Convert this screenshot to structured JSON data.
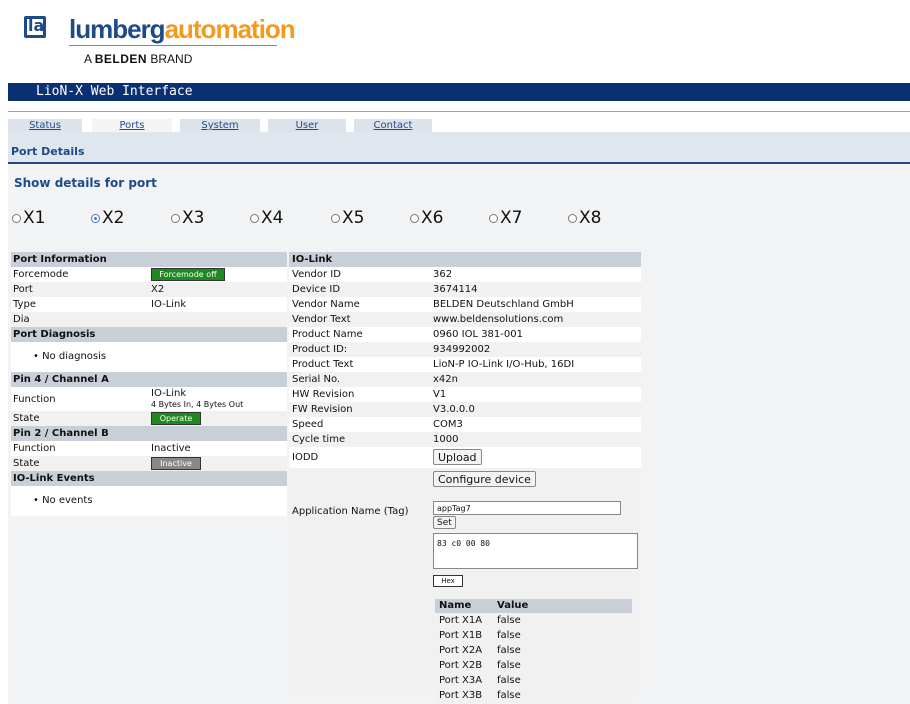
{
  "logo": {
    "word_a": "lumberg",
    "word_b": "automation",
    "brand_prefix": "A",
    "brand_name": "BELDEN",
    "brand_suffix": "BRAND",
    "mark": "la"
  },
  "title_bar": "LioN-X Web Interface",
  "tabs": [
    {
      "label": "Status"
    },
    {
      "label": "Ports"
    },
    {
      "label": "System"
    },
    {
      "label": "User"
    },
    {
      "label": "Contact"
    }
  ],
  "section_title": "Port Details",
  "show_details_label": "Show details for port",
  "ports": [
    "X1",
    "X2",
    "X3",
    "X4",
    "X5",
    "X6",
    "X7",
    "X8"
  ],
  "selected_port": "X2",
  "port_info": {
    "heading": "Port Information",
    "forcemode_label": "Forcemode",
    "forcemode_value": "Forcemode off",
    "port_label": "Port",
    "port_value": "X2",
    "type_label": "Type",
    "type_value": "IO-Link",
    "dia_label": "Dia"
  },
  "port_diagnosis": {
    "heading": "Port Diagnosis",
    "item": "No diagnosis"
  },
  "pin4": {
    "heading": "Pin 4 / Channel A",
    "function_label": "Function",
    "function_value": "IO-Link",
    "function_sub": "4 Bytes In, 4 Bytes Out",
    "state_label": "State",
    "state_value": "Operate"
  },
  "pin2": {
    "heading": "Pin 2 / Channel B",
    "function_label": "Function",
    "function_value": "Inactive",
    "state_label": "State",
    "state_value": "Inactive"
  },
  "iolink_events": {
    "heading": "IO-Link Events",
    "item": "No events"
  },
  "iolink": {
    "heading": "IO-Link",
    "rows": [
      {
        "k": "Vendor ID",
        "v": "362"
      },
      {
        "k": "Device ID",
        "v": "3674114"
      },
      {
        "k": "Vendor Name",
        "v": "BELDEN Deutschland GmbH"
      },
      {
        "k": "Vendor Text",
        "v": "www.beldensolutions.com"
      },
      {
        "k": "Product Name",
        "v": "0960 IOL 381-001"
      },
      {
        "k": "Product ID:",
        "v": "934992002"
      },
      {
        "k": "Product Text",
        "v": "LioN-P IO-Link I/O-Hub, 16DI"
      },
      {
        "k": "Serial No.",
        "v": "x42n"
      },
      {
        "k": "HW Revision",
        "v": "V1"
      },
      {
        "k": "FW Revision",
        "v": "V3.0.0.0"
      },
      {
        "k": "Speed",
        "v": "COM3"
      },
      {
        "k": "Cycle time",
        "v": "1000"
      }
    ],
    "iodd_label": "IODD",
    "upload_button": "Upload",
    "configure_button": "Configure device",
    "app_name_label": "Application Name (Tag)",
    "app_name_value": "appTag7",
    "set_button": "Set",
    "hex_value": "83 c0 00 80",
    "hex_button": "Hex"
  },
  "nv_table": {
    "name_header": "Name",
    "value_header": "Value",
    "rows": [
      {
        "name": "Port X1A",
        "value": "false"
      },
      {
        "name": "Port X1B",
        "value": "false"
      },
      {
        "name": "Port X2A",
        "value": "false"
      },
      {
        "name": "Port X2B",
        "value": "false"
      },
      {
        "name": "Port X3A",
        "value": "false"
      },
      {
        "name": "Port X3B",
        "value": "false"
      }
    ]
  }
}
